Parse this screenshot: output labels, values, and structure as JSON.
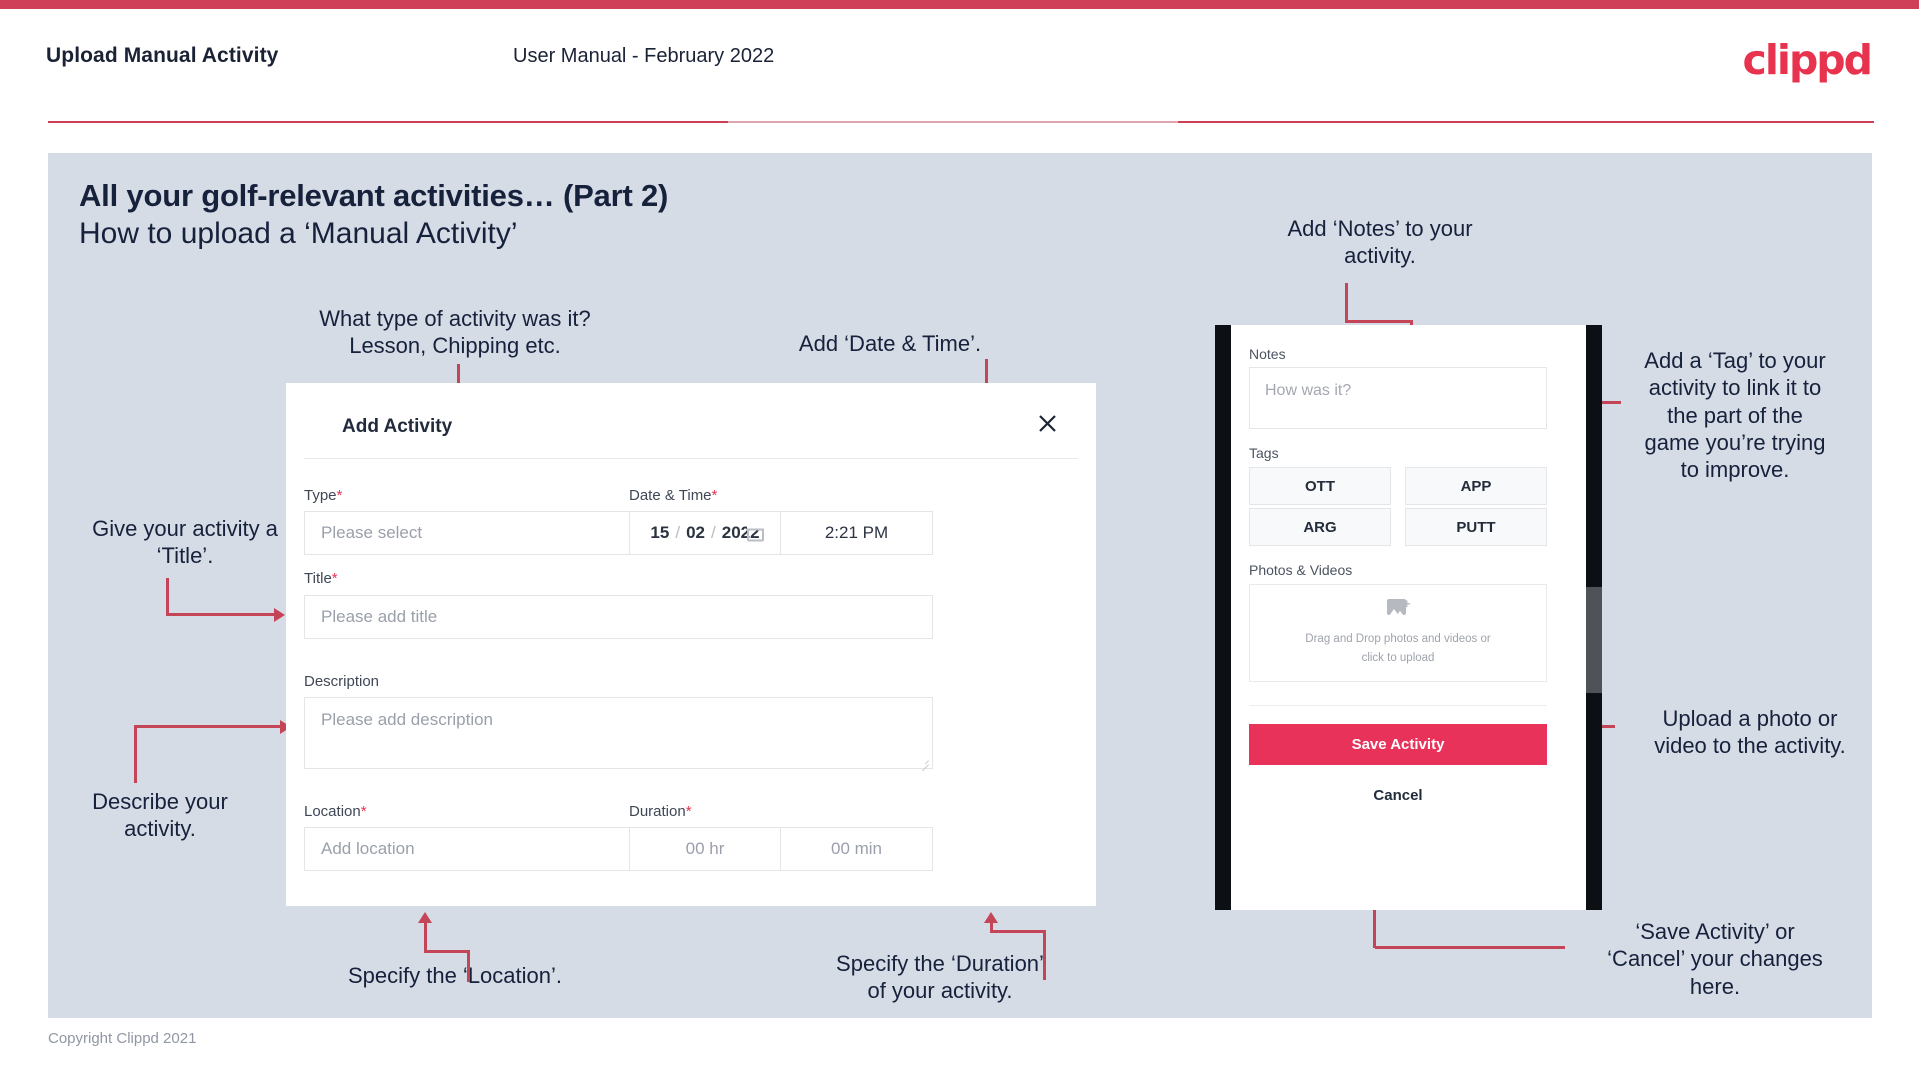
{
  "header": {
    "title": "Upload Manual Activity",
    "subtitle": "User Manual - February 2022",
    "logo": "clippd"
  },
  "slide": {
    "title": "All your golf-relevant activities… (Part 2)",
    "subtitle": "How to upload a ‘Manual Activity’"
  },
  "annotations": {
    "type": "What type of activity was it?\nLesson, Chipping etc.",
    "datetime": "Add ‘Date & Time’.",
    "title": "Give your activity a\n‘Title’.",
    "description": "Describe your\nactivity.",
    "location": "Specify the ‘Location’.",
    "duration": "Specify the ‘Duration’\nof your activity.",
    "notes": "Add ‘Notes’ to your\nactivity.",
    "tags": "Add a ‘Tag’ to your\nactivity to link it to\nthe part of the\ngame you’re trying\nto improve.",
    "upload": "Upload a photo or\nvideo to the activity.",
    "save": "‘Save Activity’ or\n‘Cancel’ your changes\nhere."
  },
  "dialog": {
    "title": "Add Activity",
    "close_icon": "close-icon",
    "fields": {
      "type": {
        "label": "Type",
        "required": "*",
        "placeholder": "Please select"
      },
      "datetime": {
        "label": "Date & Time",
        "required": "*",
        "day": "15",
        "month": "02",
        "year": "2022",
        "sep": "/",
        "time": "2:21 PM"
      },
      "title": {
        "label": "Title",
        "required": "*",
        "placeholder": "Please add title"
      },
      "description": {
        "label": "Description",
        "required": "",
        "placeholder": "Please add description"
      },
      "location": {
        "label": "Location",
        "required": "*",
        "placeholder": "Add location"
      },
      "duration": {
        "label": "Duration",
        "required": "*",
        "hours": "00 hr",
        "minutes": "00 min"
      }
    }
  },
  "phone": {
    "notes": {
      "label": "Notes",
      "placeholder": "How was it?"
    },
    "tags": {
      "label": "Tags",
      "items": [
        "OTT",
        "APP",
        "ARG",
        "PUTT"
      ]
    },
    "photos": {
      "label": "Photos & Videos",
      "drop_line1": "Drag and Drop photos and videos or",
      "drop_line2": "click to upload"
    },
    "save_label": "Save Activity",
    "cancel_label": "Cancel"
  },
  "footer": {
    "copyright": "Copyright Clippd 2021"
  },
  "colors": {
    "accent": "#e8334f",
    "accent_bar": "#cf4058",
    "connector": "#c44458",
    "slide_bg": "#d6dce5",
    "text_dark": "#16213c",
    "save_button": "#e8325a"
  }
}
